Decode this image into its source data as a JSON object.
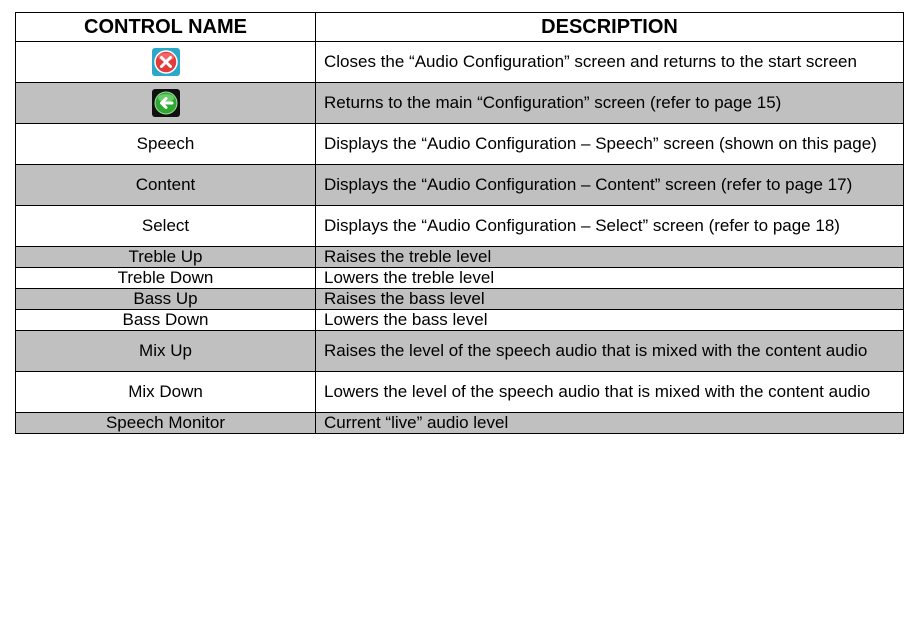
{
  "headers": {
    "control": "CONTROL NAME",
    "description": "DESCRIPTION"
  },
  "rows": [
    {
      "icon": "close-icon",
      "description": "Closes the “Audio Configuration” screen and returns to the start screen"
    },
    {
      "icon": "back-arrow-icon",
      "description": "Returns to the main “Configuration” screen (refer to page 15)"
    },
    {
      "name": "Speech",
      "description": "Displays the “Audio Configuration – Speech” screen (shown on this page)"
    },
    {
      "name": "Content",
      "description": "Displays the “Audio Configuration – Content” screen (refer to page 17)"
    },
    {
      "name": "Select",
      "description": "Displays the “Audio Configuration – Select” screen (refer to page 18)"
    },
    {
      "name": "Treble Up",
      "description": "Raises the treble level"
    },
    {
      "name": "Treble Down",
      "description": "Lowers the treble level"
    },
    {
      "name": "Bass Up",
      "description": "Raises the bass level"
    },
    {
      "name": "Bass Down",
      "description": "Lowers the bass level"
    },
    {
      "name": "Mix Up",
      "description": "Raises the level of the speech audio that is mixed with the content audio"
    },
    {
      "name": "Mix Down",
      "description": "Lowers the level of the speech audio that is mixed with the content audio"
    },
    {
      "name": "Speech Monitor",
      "description": "Current “live” audio level"
    }
  ],
  "colors": {
    "row_alt": "#c0c0c0",
    "close_icon_red": "#e23b3b",
    "close_icon_bg": "#2aa7c9",
    "back_icon_green": "#2fa832"
  }
}
